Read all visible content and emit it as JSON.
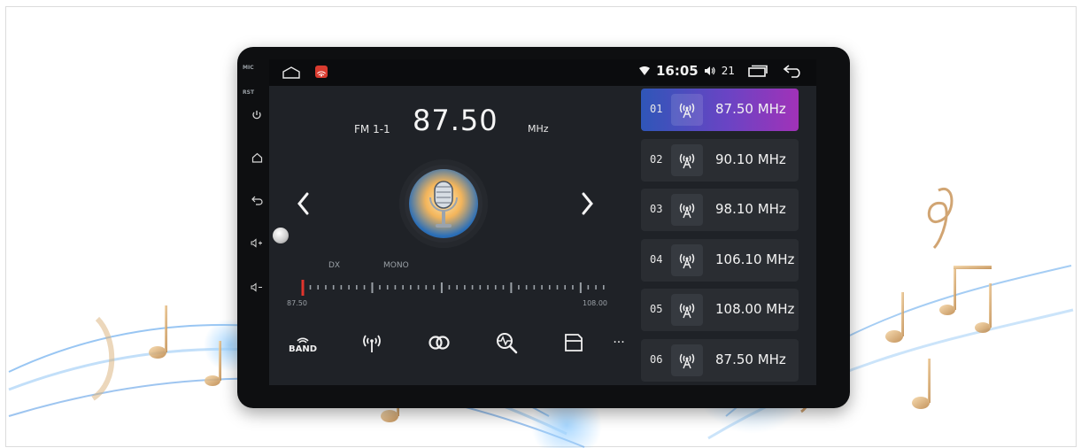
{
  "device": {
    "side_labels": {
      "mic": "MIC",
      "rst": "RST"
    }
  },
  "statusbar": {
    "time": "16:05",
    "volume": "21",
    "icons": [
      "home-icon",
      "app-icon",
      "wifi-icon",
      "volume-icon",
      "recent-apps-icon",
      "back-icon"
    ]
  },
  "radio": {
    "band": "FM 1-1",
    "frequency": "87.50",
    "unit": "MHz",
    "dx_label": "DX",
    "mono_label": "MONO",
    "scale_min": "87.50",
    "scale_max": "108.00",
    "tuner_position": 0.0
  },
  "toolbar": {
    "band_label": "BAND",
    "icons": [
      "band-icon",
      "antenna-icon",
      "stereo-icon",
      "scan-icon",
      "save-icon",
      "more-icon"
    ],
    "more_label": "···"
  },
  "presets": [
    {
      "num": "01",
      "freq": "87.50 MHz",
      "active": true
    },
    {
      "num": "02",
      "freq": "90.10 MHz",
      "active": false
    },
    {
      "num": "03",
      "freq": "98.10 MHz",
      "active": false
    },
    {
      "num": "04",
      "freq": "106.10 MHz",
      "active": false
    },
    {
      "num": "05",
      "freq": "108.00 MHz",
      "active": false
    },
    {
      "num": "06",
      "freq": "87.50 MHz",
      "active": false
    }
  ],
  "colors": {
    "accent_gradient_start": "#2f56b8",
    "accent_gradient_end": "#a132b8",
    "tuner_needle": "#e0342d",
    "screen_bg": "#1f2227"
  }
}
